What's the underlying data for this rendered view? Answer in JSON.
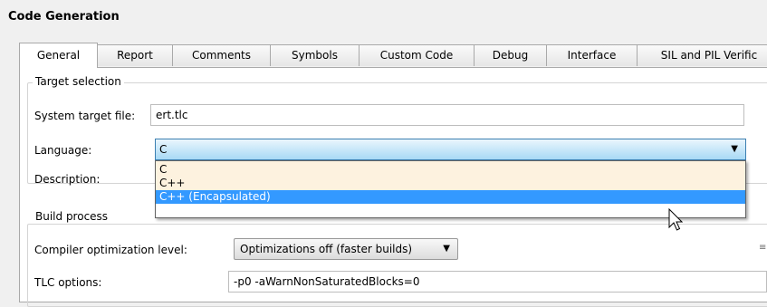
{
  "section_title": "Code Generation",
  "tabs": [
    {
      "label": "General",
      "active": true
    },
    {
      "label": "Report"
    },
    {
      "label": "Comments"
    },
    {
      "label": "Symbols"
    },
    {
      "label": "Custom Code"
    },
    {
      "label": "Debug"
    },
    {
      "label": "Interface"
    },
    {
      "label": "SIL and PIL Verific"
    }
  ],
  "target_selection": {
    "legend": "Target selection",
    "system_target_file_label": "System target file:",
    "system_target_file_value": "ert.tlc",
    "language_label": "Language:",
    "language_value": "C",
    "description_label": "Description:"
  },
  "language_dropdown": {
    "options": [
      "C",
      "C++",
      "C++ (Encapsulated)"
    ],
    "hovered": "C++ (Encapsulated)"
  },
  "build_process": {
    "legend": "Build process",
    "compiler_opt_label": "Compiler optimization level:",
    "compiler_opt_value": "Optimizations off (faster builds)",
    "tlc_options_label": "TLC options:",
    "tlc_options_value": "-p0 -aWarnNonSaturatedBlocks=0"
  },
  "icons": {
    "dropdown_arrow": "chevron-down-icon",
    "mouse_cursor": "cursor-icon",
    "grip": "grip-icon"
  },
  "colors": {
    "highlight": "#3399ff",
    "hover_item": "#fdf2df",
    "combo_border": "#3c7fb1"
  }
}
